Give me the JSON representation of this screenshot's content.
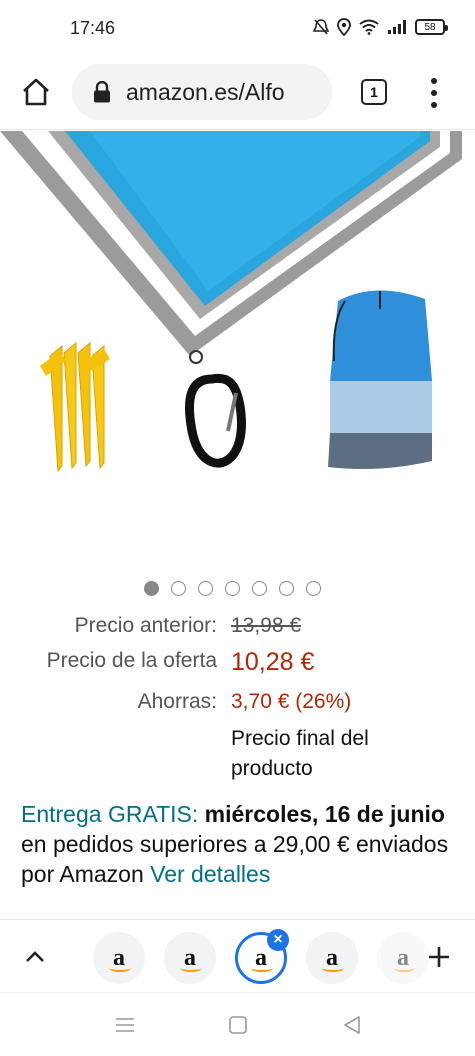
{
  "status_bar": {
    "time": "17:46",
    "battery": "58",
    "icons": [
      "mute-icon",
      "location-icon",
      "wifi-icon",
      "signal-icon",
      "battery-icon"
    ]
  },
  "browser": {
    "url": "amazon.es/Alfo",
    "tab_count": "1"
  },
  "carousel": {
    "total": 7,
    "active_index": 0
  },
  "pricing": {
    "previous_label": "Precio anterior:",
    "previous_value": "13,98 €",
    "deal_label": "Precio de la oferta",
    "deal_value": "10,28 €",
    "savings_label": "Ahorras:",
    "savings_value": "3,70 € (26%)",
    "final_note": "Precio final del producto"
  },
  "delivery": {
    "free_label": "Entrega GRATIS:",
    "date": "miércoles, 16 de junio",
    "condition": "en pedidos superiores a 29,00 € enviados por Amazon",
    "details_link": "Ver detalles"
  },
  "tab_strip": {
    "thumb_letter": "a",
    "tabs": 5,
    "active_tab": 2
  },
  "colors": {
    "price_red": "#b12704",
    "link_teal": "#007185",
    "accent_blue": "#1a73e8"
  }
}
